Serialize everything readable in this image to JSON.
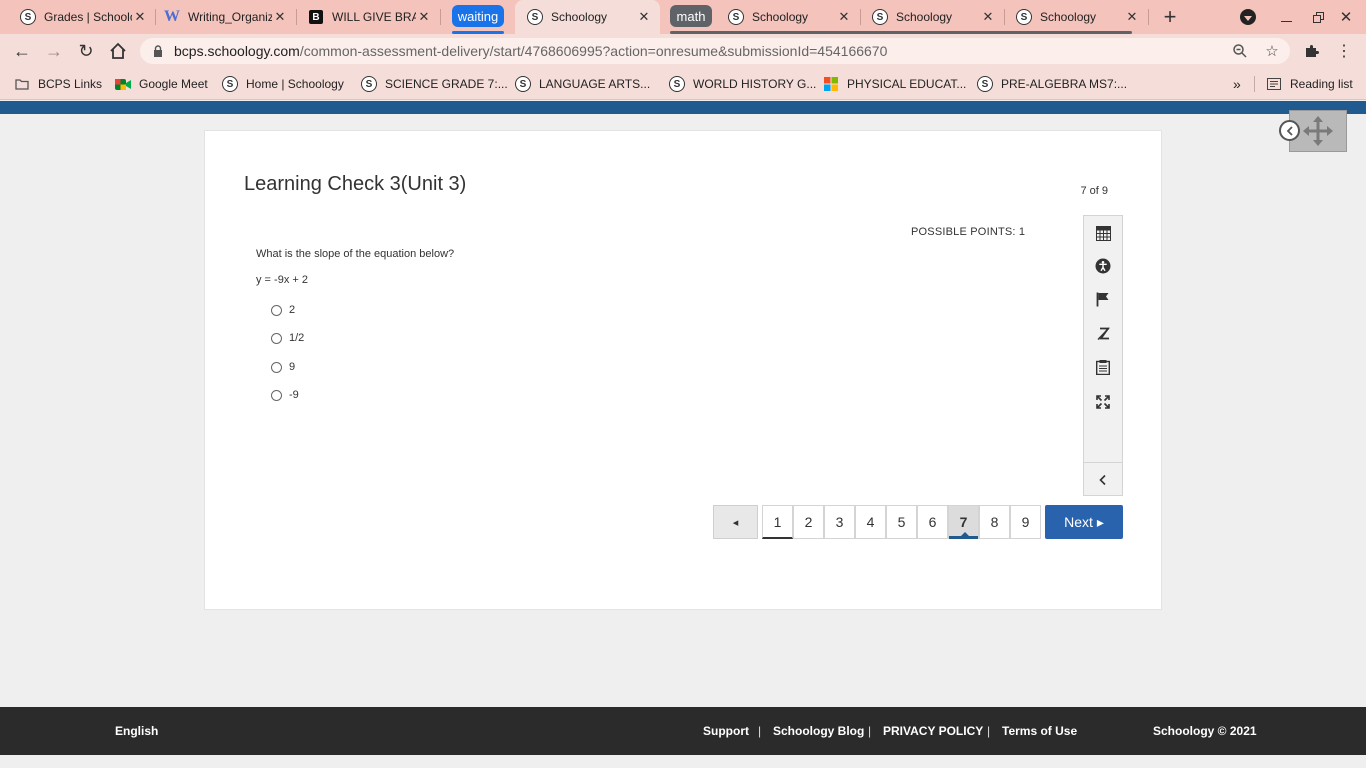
{
  "browser": {
    "tabs": [
      {
        "title": "Grades | Schoology",
        "icon": "schoology-icon"
      },
      {
        "title": "Writing_Organizer",
        "icon": "word-icon"
      },
      {
        "title": "WILL GIVE BRAINLIEST",
        "icon": "brainly-icon"
      },
      {
        "title": "Schoology",
        "icon": "schoology-icon"
      },
      {
        "title": "Schoology",
        "icon": "schoology-icon"
      },
      {
        "title": "Schoology",
        "icon": "schoology-icon"
      },
      {
        "title": "Schoology",
        "icon": "schoology-icon"
      }
    ],
    "groups": [
      {
        "label": "waiting",
        "color": "#1a73e8"
      },
      {
        "label": "math",
        "color": "#5f6368"
      }
    ],
    "url_host": "bcps.schoology.com",
    "url_path": "/common-assessment-delivery/start/4768606995?action=onresume&submissionId=454166670",
    "bookmarks": [
      {
        "label": "BCPS Links",
        "icon": "folder-icon"
      },
      {
        "label": "Google Meet",
        "icon": "google-meet-icon"
      },
      {
        "label": "Home | Schoology",
        "icon": "schoology-icon"
      },
      {
        "label": "SCIENCE GRADE 7:...",
        "icon": "schoology-icon"
      },
      {
        "label": "LANGUAGE ARTS...",
        "icon": "schoology-icon"
      },
      {
        "label": "WORLD HISTORY G...",
        "icon": "schoology-icon"
      },
      {
        "label": "PHYSICAL EDUCAT...",
        "icon": "microsoft-icon"
      },
      {
        "label": "PRE-ALGEBRA MS7:...",
        "icon": "schoology-icon"
      }
    ],
    "overflow_label": "»",
    "reading_list": "Reading list",
    "colors": {
      "frame": "#f4c3bb",
      "toolbar": "#f5ded9"
    }
  },
  "assessment": {
    "title": "Learning Check 3(Unit 3)",
    "position": "7 of 9",
    "points": "POSSIBLE POINTS: 1",
    "question": "What is the slope of the equation below?",
    "equation": "y = -9x  + 2",
    "choices": [
      "2",
      "1/2",
      "9",
      "-9"
    ],
    "pages": [
      "1",
      "2",
      "3",
      "4",
      "5",
      "6",
      "7",
      "8",
      "9"
    ],
    "current_page": "7",
    "prev_label": "◂",
    "next_label": "Next ▸",
    "tools": [
      "calculator-icon",
      "accessibility-icon",
      "flag-icon",
      "strikethrough-icon",
      "notepad-icon",
      "fullscreen-icon",
      "collapse-panel-icon"
    ],
    "colors": {
      "brand": "#215a8e",
      "next_button": "#2a63ad"
    }
  },
  "footer": {
    "language": "English",
    "links": [
      "Support",
      "Schoology Blog",
      "PRIVACY POLICY",
      "Terms of Use"
    ],
    "separator": "|",
    "copyright": "Schoology © 2021"
  }
}
